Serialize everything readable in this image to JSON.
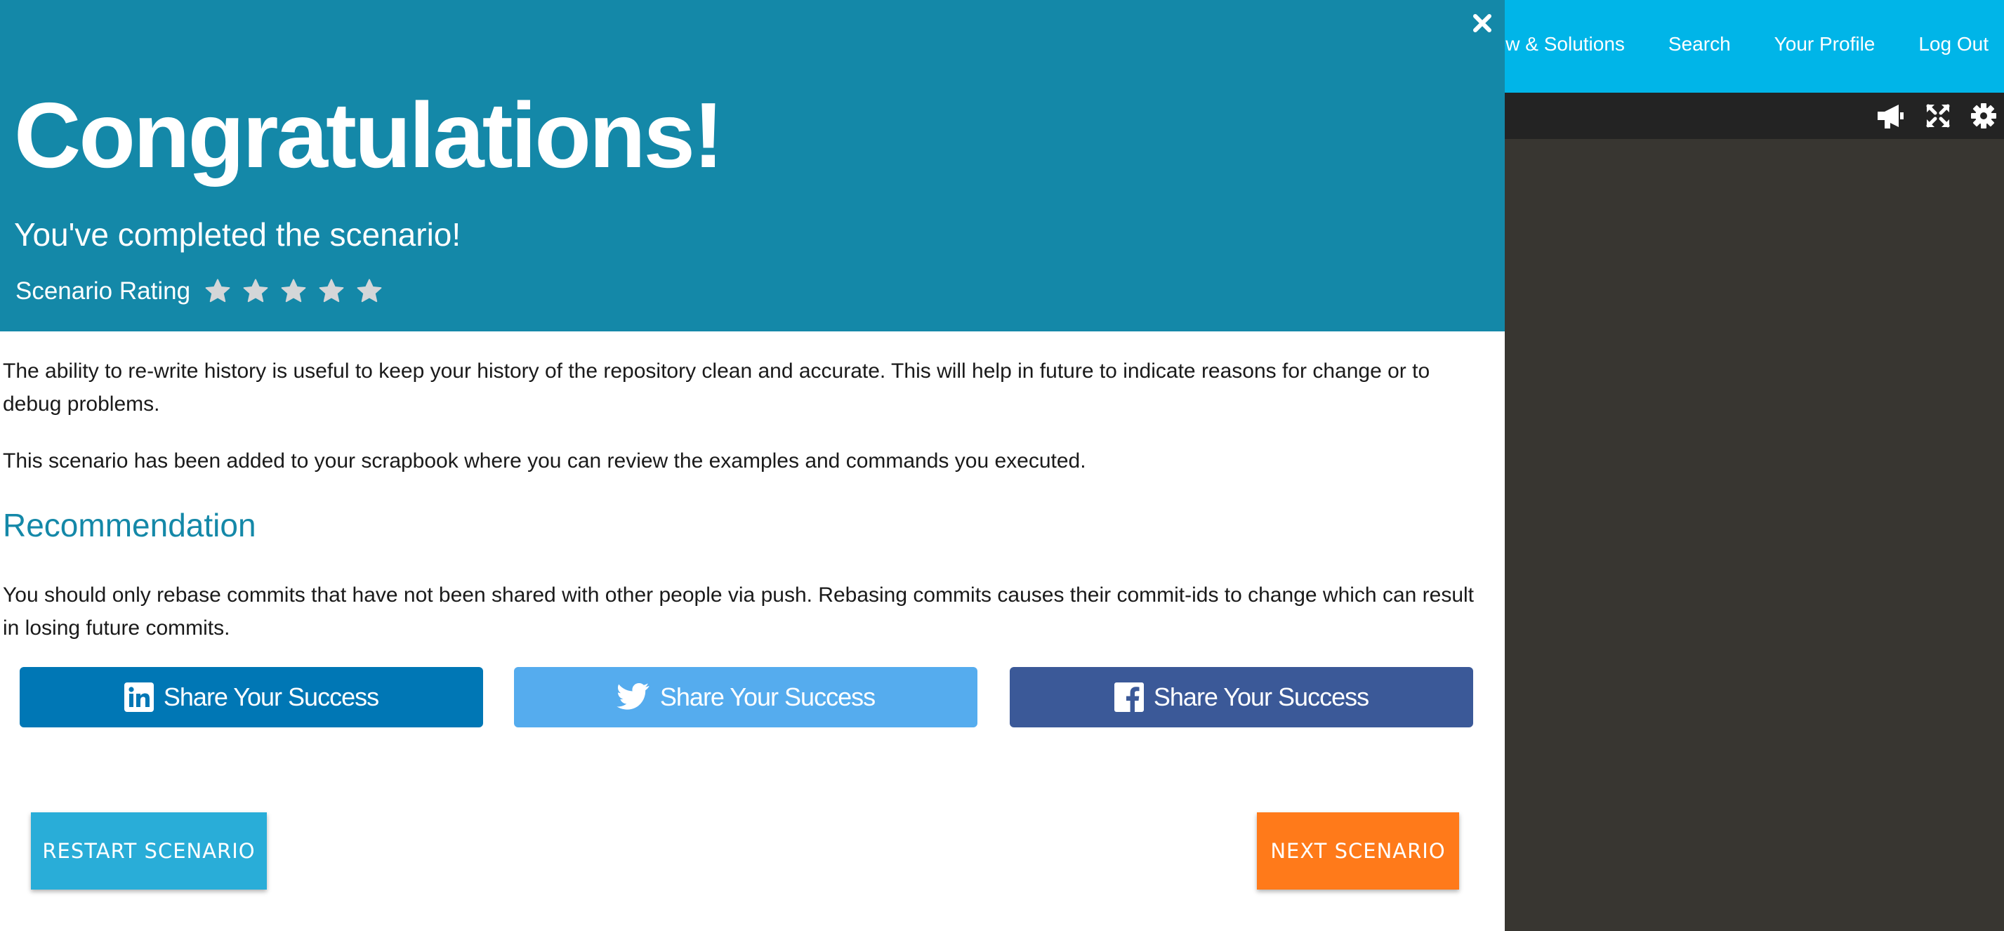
{
  "topnav": {
    "links": [
      "ew & Solutions",
      "Search",
      "Your Profile",
      "Log Out"
    ]
  },
  "terminal_toolbar": {
    "icons": [
      "megaphone-icon",
      "expand-icon",
      "gear-icon"
    ]
  },
  "modal": {
    "close_symbol": "×",
    "title": "Congratulations!",
    "subtitle": "You've completed the scenario!",
    "rating_label": "Scenario Rating",
    "rating_star_count": 5,
    "paragraph1": "The ability to re-write history is useful to keep your history of the repository clean and accurate. This will help in future to indicate reasons for change or to debug problems.",
    "paragraph2": "This scenario has been added to your scrapbook where you can review the examples and commands you executed.",
    "recommendation_heading": "Recommendation",
    "paragraph3": "You should only rebase commits that have not been shared with other people via push. Rebasing commits causes their commit-ids to change which can result in losing future commits.",
    "share": {
      "linkedin_label": "Share Your Success",
      "twitter_label": "Share Your Success",
      "facebook_label": "Share Your Success"
    },
    "restart_label": "RESTART SCENARIO",
    "next_label": "NEXT SCENARIO"
  },
  "colors": {
    "header_bg": "#1488a8",
    "topnav_bg": "#00b5e8",
    "linkedin": "#0077b5",
    "twitter": "#55acee",
    "facebook": "#3b5998",
    "restart": "#29add8",
    "next": "#ff7a1a"
  }
}
